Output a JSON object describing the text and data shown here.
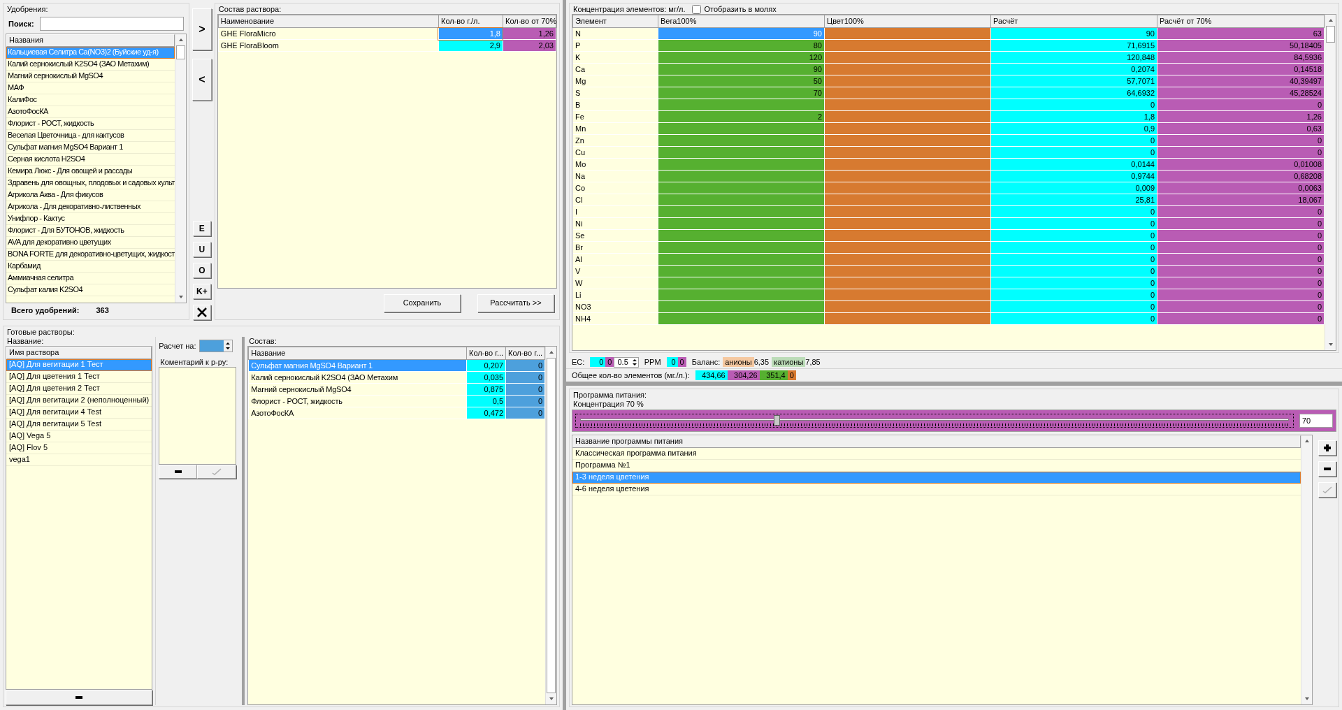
{
  "fertilizers": {
    "title": "Удобрения:",
    "search_label": "Поиск:",
    "column": "Названия",
    "items": [
      {
        "name": "Кальциевая Селитра Ca(NO3)2 (Буйские уд-я)",
        "selected": true
      },
      {
        "name": "Калий  сернокислый  K2SO4 (ЗАО Метахим)",
        "selected": false
      },
      {
        "name": "Магний сернокислый MgSO4",
        "selected": false
      },
      {
        "name": "МАФ",
        "selected": false
      },
      {
        "name": "КалиФос",
        "selected": false
      },
      {
        "name": "АзотоФосКА",
        "selected": false
      },
      {
        "name": "Флорист - РОСТ, жидкость",
        "selected": false
      },
      {
        "name": "Веселая Цветочница - для кактусов",
        "selected": false
      },
      {
        "name": "Сульфат магния MgSO4 Вариант 1",
        "selected": false
      },
      {
        "name": "Серная кислота H2SO4",
        "selected": false
      },
      {
        "name": "Кемира Люкс - Для овощей и рассады",
        "selected": false
      },
      {
        "name": "Здравень для овощных, плодовых и садовых культ",
        "selected": false
      },
      {
        "name": "Агрикола Аква - Для фикусов",
        "selected": false
      },
      {
        "name": "Агрикола - Для декоративно-лиственных",
        "selected": false
      },
      {
        "name": "Унифлор - Кактус",
        "selected": false
      },
      {
        "name": "Флорист - Для БУТОНОВ, жидкость",
        "selected": false
      },
      {
        "name": "AVA для декоративно цветущих",
        "selected": false
      },
      {
        "name": "BONA FORTE для декоративно-цветущих, жидкост",
        "selected": false
      },
      {
        "name": "Карбамид",
        "selected": false
      },
      {
        "name": "Аммиачная селитра",
        "selected": false
      },
      {
        "name": "Сульфат калия K2SO4",
        "selected": false
      }
    ],
    "total_label": "Всего удобрений:",
    "total": "363"
  },
  "move_buttons": [
    ">",
    "<"
  ],
  "tool_buttons": [
    "E",
    "U",
    "O",
    "K+"
  ],
  "composition": {
    "title": "Состав раствора:",
    "columns": [
      "Наименование",
      "Кол-во г./л.",
      "Кол-во от 70%"
    ],
    "rows": [
      {
        "name": "GHE FloraMicro",
        "qty": "1,8",
        "qty70": "1,26",
        "selected": true
      },
      {
        "name": "GHE FloraBloom",
        "qty": "2,9",
        "qty70": "2,03",
        "selected": false
      }
    ],
    "buttons": [
      "Сохранить",
      "Рассчитать >>"
    ]
  },
  "elements": {
    "title": "Концентрация элементов: мг/л.",
    "moles_label": "Отобразить в молях",
    "moles_checked": false,
    "columns": [
      "Элемент",
      "Вега100%",
      "Цвет100%",
      "Расчёт",
      "Расчёт от 70%"
    ],
    "rows": [
      {
        "element": "N",
        "vega": "90",
        "calc": "90",
        "calc70": "63",
        "selected": true
      },
      {
        "element": "P",
        "vega": "80",
        "calc": "71,6915",
        "calc70": "50,18405",
        "selected": false
      },
      {
        "element": "K",
        "vega": "120",
        "calc": "120,848",
        "calc70": "84,5936",
        "selected": false
      },
      {
        "element": "Ca",
        "vega": "90",
        "calc": "0,2074",
        "calc70": "0,14518",
        "selected": false
      },
      {
        "element": "Mg",
        "vega": "50",
        "calc": "57,7071",
        "calc70": "40,39497",
        "selected": false
      },
      {
        "element": "S",
        "vega": "70",
        "calc": "64,6932",
        "calc70": "45,28524",
        "selected": false
      },
      {
        "element": "B",
        "calc": "0",
        "calc70": "0",
        "selected": false
      },
      {
        "element": "Fe",
        "vega": "2",
        "calc": "1,8",
        "calc70": "1,26",
        "selected": false
      },
      {
        "element": "Mn",
        "calc": "0,9",
        "calc70": "0,63",
        "selected": false
      },
      {
        "element": "Zn",
        "calc": "0",
        "calc70": "0",
        "selected": false
      },
      {
        "element": "Cu",
        "calc": "0",
        "calc70": "0",
        "selected": false
      },
      {
        "element": "Mo",
        "calc": "0,0144",
        "calc70": "0,01008",
        "selected": false
      },
      {
        "element": "Na",
        "calc": "0,9744",
        "calc70": "0,68208",
        "selected": false
      },
      {
        "element": "Co",
        "calc": "0,009",
        "calc70": "0,0063",
        "selected": false
      },
      {
        "element": "Cl",
        "calc": "25,81",
        "calc70": "18,067",
        "selected": false
      },
      {
        "element": "I",
        "calc": "0",
        "calc70": "0",
        "selected": false
      },
      {
        "element": "Ni",
        "calc": "0",
        "calc70": "0",
        "selected": false
      },
      {
        "element": "Se",
        "calc": "0",
        "calc70": "0",
        "selected": false
      },
      {
        "element": "Br",
        "calc": "0",
        "calc70": "0",
        "selected": false
      },
      {
        "element": "Al",
        "calc": "0",
        "calc70": "0",
        "selected": false
      },
      {
        "element": "V",
        "calc": "0",
        "calc70": "0",
        "selected": false
      },
      {
        "element": "W",
        "calc": "0",
        "calc70": "0",
        "selected": false
      },
      {
        "element": "Li",
        "calc": "0",
        "calc70": "0",
        "selected": false
      },
      {
        "element": "NO3",
        "calc": "0",
        "calc70": "0",
        "selected": false
      },
      {
        "element": "NH4",
        "calc": "0",
        "calc70": "0",
        "selected": false
      }
    ]
  },
  "ec_bar": {
    "ec_label": "EC:",
    "ec": "0",
    "ec70": "0",
    "step": "0.5",
    "ppm_label": "PPM",
    "ppm": "0",
    "ppm70": "0",
    "balance_label": "Баланс:",
    "anions_label": "анионы",
    "anions": "6,35",
    "cations_label": "катионы",
    "cations": "7,85"
  },
  "totals": {
    "label": "Общее кол-во элементов (мг./л.):",
    "calc": "434,66",
    "calc70": "304,26",
    "vega": "351,4",
    "color100": "0"
  },
  "ready": {
    "title": "Готовые растворы:",
    "names_title": "Название:",
    "column": "Имя раствора",
    "items": [
      {
        "name": "[AQ] Для вегитации 1 Тест",
        "selected": true
      },
      {
        "name": "[AQ] Для цветения 1 Тест",
        "selected": false
      },
      {
        "name": "[AQ] Для цветения 2 Тест",
        "selected": false
      },
      {
        "name": "[AQ] Для вегитации 2 (неполноценный)",
        "selected": false
      },
      {
        "name": "[AQ] Для вегитации 4 Test",
        "selected": false
      },
      {
        "name": "[AQ] Для вегитации 5 Test",
        "selected": false
      },
      {
        "name": "[AQ] Vega 5",
        "selected": false
      },
      {
        "name": "[AQ] Flov 5",
        "selected": false
      },
      {
        "name": "vega1",
        "selected": false
      }
    ],
    "calc_label": "Расчет на:",
    "comment_title": "Коментарий к р-ру:",
    "contents_title": "Состав:",
    "contents_columns": [
      "Название",
      "Кол-во г...",
      "Кол-во г..."
    ],
    "contents": [
      {
        "name": "Сульфат магния MgSO4 Вариант 1",
        "qty": "0,207",
        "qty2": "0",
        "selected": true
      },
      {
        "name": "Калий  сернокислый  K2SO4 (ЗАО Метахим",
        "qty": "0,035",
        "qty2": "0",
        "selected": false
      },
      {
        "name": "Магний сернокислый MgSO4",
        "qty": "0,875",
        "qty2": "0",
        "selected": false
      },
      {
        "name": "Флорист - РОСТ, жидкость",
        "qty": "0,5",
        "qty2": "0",
        "selected": false
      },
      {
        "name": "АзотоФосКА",
        "qty": "0,472",
        "qty2": "0",
        "selected": false
      }
    ]
  },
  "program": {
    "title": "Программа питания:",
    "concentration_title": "Концентрация 70 %",
    "level": 0.28,
    "value": "70",
    "column": "Название программы питания",
    "items": [
      {
        "name": "Классическая программа питания",
        "selected": false
      },
      {
        "name": "Программа №1",
        "selected": false
      },
      {
        "name": "1-3 неделя цветения",
        "selected": true
      },
      {
        "name": "4-6 неделя цветения",
        "selected": false
      }
    ]
  }
}
